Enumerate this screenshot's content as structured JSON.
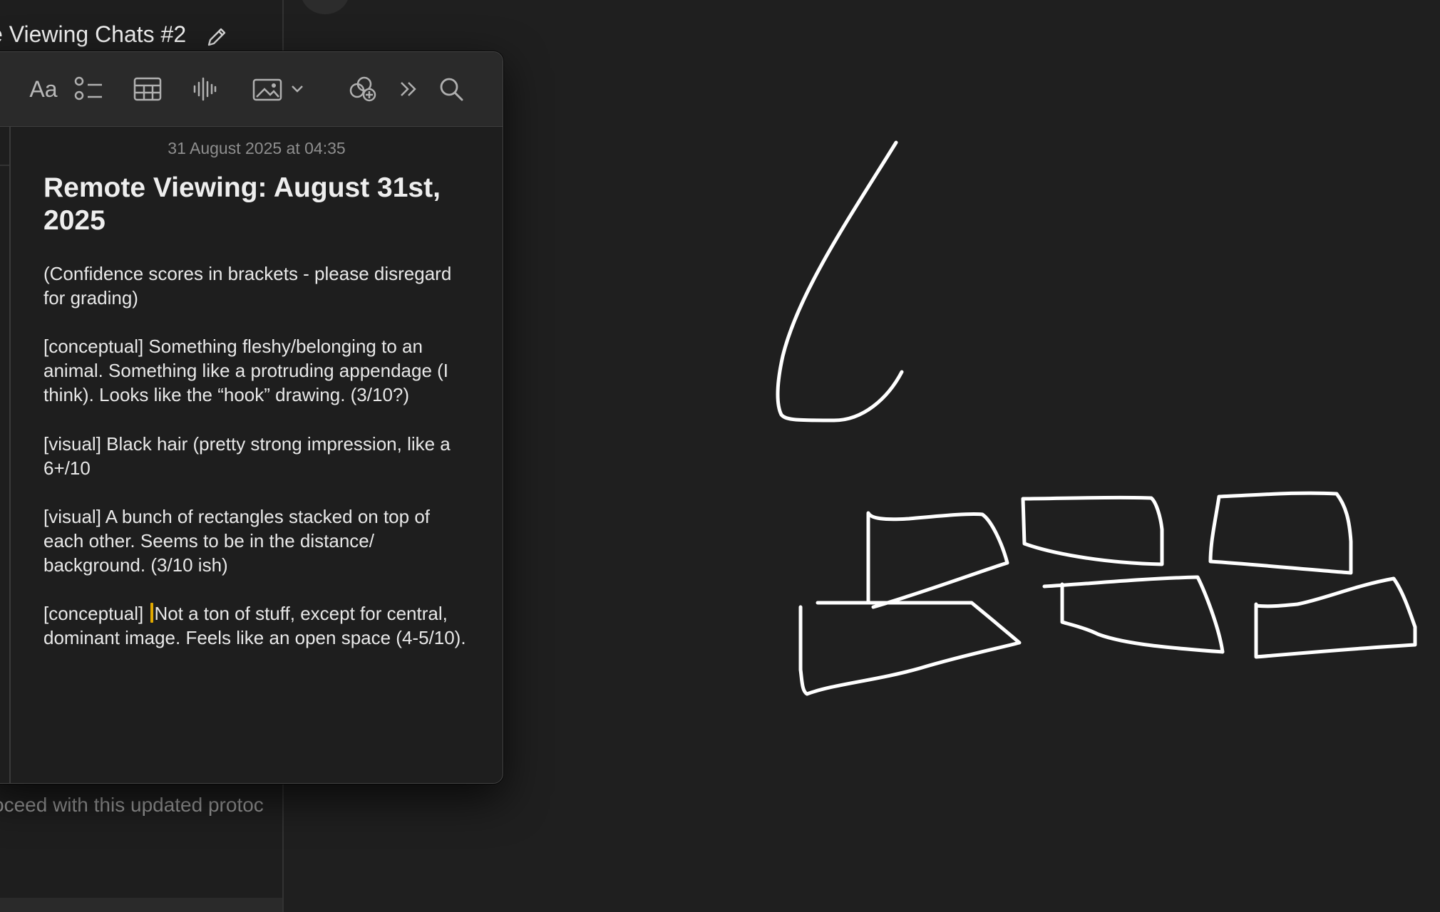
{
  "chat": {
    "title": "e Viewing Chats #2",
    "footer_text": "oceed with this updated protoc"
  },
  "toolbar": {
    "items": [
      {
        "icon": "text-format-icon",
        "label": "Aa"
      },
      {
        "icon": "checklist-icon"
      },
      {
        "icon": "table-icon"
      },
      {
        "icon": "audio-waveform-icon"
      },
      {
        "icon": "media-icon"
      },
      {
        "icon": "chevron-down-icon"
      },
      {
        "icon": "collaborate-icon"
      },
      {
        "icon": "more-icon"
      },
      {
        "icon": "search-icon"
      }
    ]
  },
  "note": {
    "date": "31 August 2025 at 04:35",
    "title": "Remote Viewing: August 31st, 2025",
    "paragraphs": [
      "(Confidence scores in brackets - please disregard for grading)",
      "[conceptual] Something fleshy/belonging to an animal. Something like a protruding appendage (I think). Looks like the “hook” drawing. (3/10?)",
      "[visual] Black hair (pretty strong impression, like a 6+/10",
      "[visual] A bunch of rectangles stacked on top of each other. Seems to be in the distance/ background. (3/10 ish)"
    ],
    "last_paragraph": {
      "before_cursor": "[conceptual] ",
      "after_cursor": "Not a ton of stuff, except for central, dominant image. Feels like an open space (4-5/10)."
    }
  },
  "colors": {
    "background": "#1f1f1f",
    "stroke": "#ffffff",
    "cursor": "#e0a800"
  }
}
